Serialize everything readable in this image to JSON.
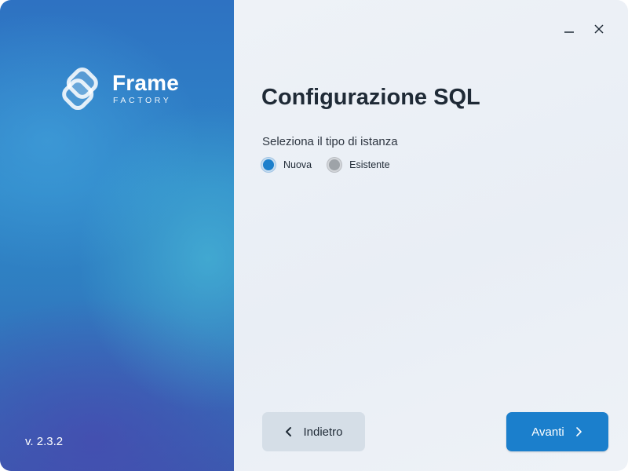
{
  "brand": {
    "name": "Frame",
    "subtitle": "FACTORY",
    "version": "v. 2.3.2"
  },
  "window_controls": {
    "minimize_icon": "minimize-icon",
    "close_icon": "close-icon"
  },
  "page": {
    "title": "Configurazione SQL",
    "instance_label": "Seleziona il tipo di istanza",
    "instance_options": [
      {
        "label": "Nuova",
        "selected": true
      },
      {
        "label": "Esistente",
        "selected": false
      }
    ]
  },
  "footer": {
    "back_label": "Indietro",
    "next_label": "Avanti"
  },
  "colors": {
    "accent": "#1b7fcc",
    "title_text": "#1f2a36",
    "back_button_bg": "#d5dee7",
    "panel_gradient_top": "#2e72c2",
    "panel_gradient_bottom": "#3a5cb0"
  }
}
